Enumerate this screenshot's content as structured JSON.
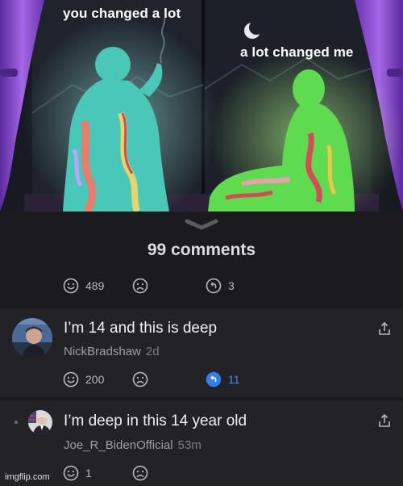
{
  "meme": {
    "caption_left": "you changed a lot",
    "caption_right": "a lot changed me"
  },
  "comments_header": {
    "count_label": "99 comments"
  },
  "post_actions": {
    "like_count": "489",
    "reply_count": "3"
  },
  "comments": [
    {
      "text": "I’m 14 and this is deep",
      "author": "NickBradshaw",
      "time": "2d",
      "like_count": "200",
      "reply_count": "11"
    },
    {
      "text": "I’m deep in this 14 year old",
      "author": "Joe_R_BidenOfficial",
      "time": "53m",
      "like_count": "1"
    }
  ],
  "watermark": "imgflip.com",
  "colors": {
    "background": "#1b1b1f",
    "comment_background": "#232327",
    "reply_accent": "#3d8bfd",
    "curtain": "#8a4fd0",
    "figure_left": "#49c7b7",
    "figure_right": "#5fdb4f"
  },
  "icons": [
    "smile-icon",
    "frown-icon",
    "reply-icon",
    "share-icon",
    "chevron-down-icon",
    "moon-icon"
  ]
}
